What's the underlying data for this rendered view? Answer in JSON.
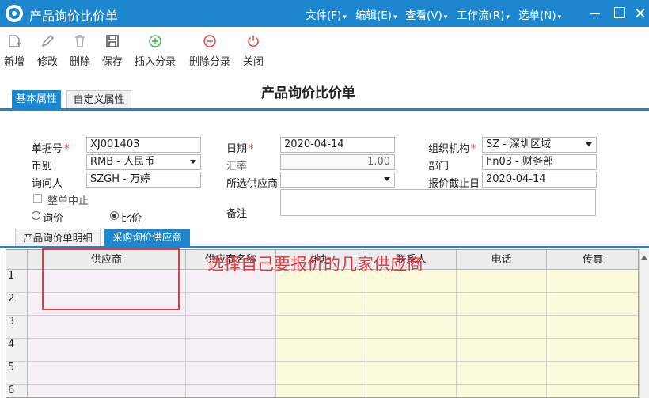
{
  "window": {
    "title": "产品询价比价单"
  },
  "menus": [
    "文件(F)",
    "编辑(E)",
    "查看(V)",
    "工作流(R)",
    "选单(N)"
  ],
  "window_buttons": {
    "minimize": "minimize-icon",
    "maximize": "maximize-icon",
    "close": "×"
  },
  "toolbar": [
    {
      "label": "新增",
      "icon": "new-icon"
    },
    {
      "label": "修改",
      "icon": "edit-icon"
    },
    {
      "label": "删除",
      "icon": "delete-icon"
    },
    {
      "label": "保存",
      "icon": "save-icon"
    },
    {
      "label": "插入分录",
      "icon": "insert-row-icon"
    },
    {
      "label": "删除分录",
      "icon": "delete-row-icon"
    },
    {
      "label": "关闭",
      "icon": "power-icon"
    }
  ],
  "tabs": [
    "基本属性",
    "自定义属性"
  ],
  "doc_title": "产品询价比价单",
  "form": {
    "bill_no": {
      "label": "单据号",
      "value": "XJ001403"
    },
    "currency": {
      "label": "币别",
      "value": "RMB - 人民币"
    },
    "inquirer": {
      "label": "询问人",
      "value": "SZGH - 万婷"
    },
    "date": {
      "label": "日期",
      "value": "2020-04-14"
    },
    "rate": {
      "label": "汇率",
      "value": "1.00"
    },
    "supplier": {
      "label": "所选供应商",
      "value": ""
    },
    "org": {
      "label": "组织机构",
      "value": "SZ - 深圳区域"
    },
    "dept": {
      "label": "部门",
      "value": "hn03 - 财务部"
    },
    "deadline": {
      "label": "报价截止日",
      "value": "2020-04-14"
    },
    "whole_stop": {
      "label": "整单中止"
    },
    "radio_inquiry": {
      "label": "询价"
    },
    "radio_compare": {
      "label": "比价"
    },
    "remark": {
      "label": "备注",
      "value": ""
    }
  },
  "inner_tabs": [
    "产品询价单明细",
    "采购询价供应商"
  ],
  "grid": {
    "columns": [
      "供应商",
      "供应商名称",
      "地址",
      "联系人",
      "电话",
      "传真"
    ],
    "row_numbers": [
      "1",
      "2",
      "3",
      "4",
      "5",
      "6"
    ]
  },
  "annotation": "选择自己要报价的几家供应商",
  "colors": {
    "accent": "#1c87cf",
    "annotation": "#e8383f",
    "editable_cell": "#fbfbdc",
    "readonly_cell": "#f6f0f6"
  }
}
